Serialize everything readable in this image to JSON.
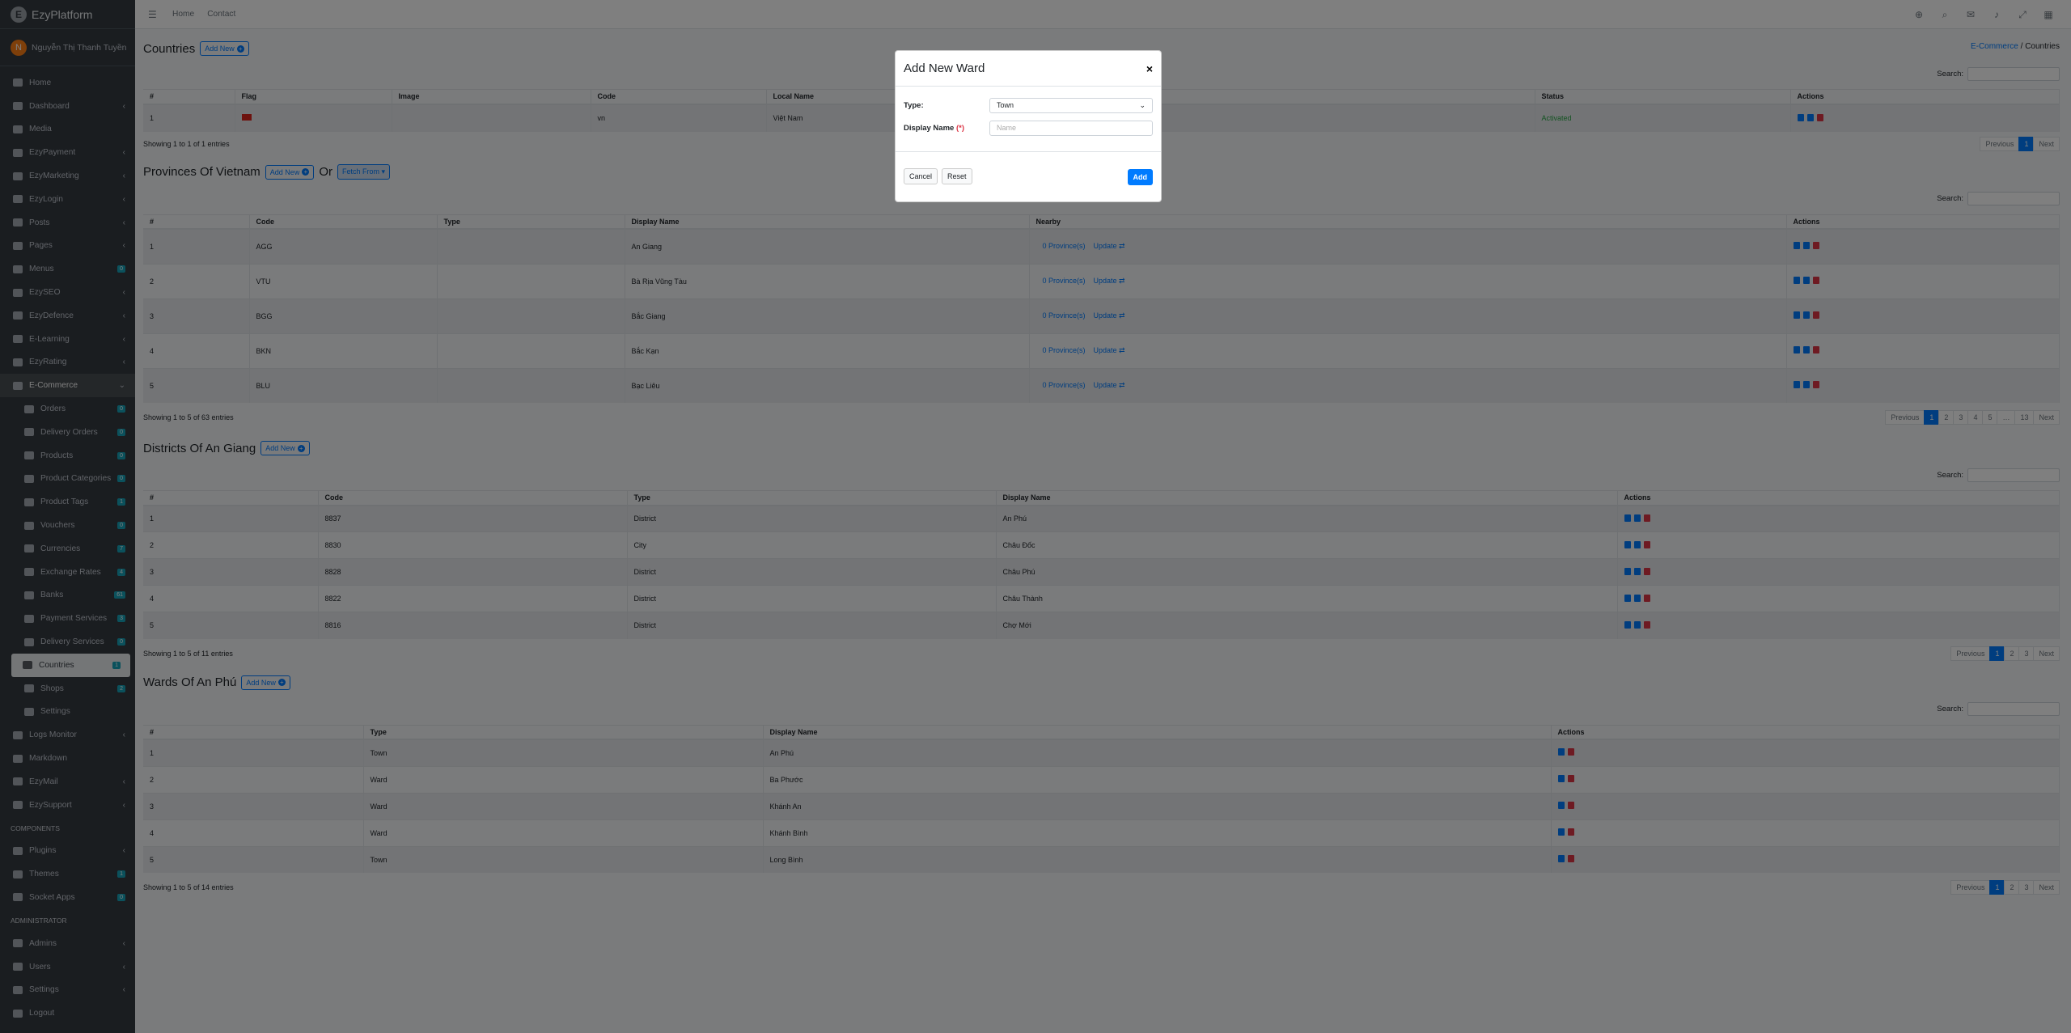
{
  "brand": "EzyPlatform",
  "user": {
    "initial": "N",
    "name": "Nguyễn Thị Thanh Tuyền"
  },
  "sidebar": {
    "top": [
      {
        "label": "Home"
      },
      {
        "label": "Dashboard",
        "chev": "‹"
      },
      {
        "label": "Media"
      },
      {
        "label": "EzyPayment",
        "chev": "‹"
      },
      {
        "label": "EzyMarketing",
        "chev": "‹"
      },
      {
        "label": "EzyLogin",
        "chev": "‹"
      },
      {
        "label": "Posts",
        "chev": "‹"
      },
      {
        "label": "Pages",
        "chev": "‹"
      },
      {
        "label": "Menus",
        "badge": "0"
      },
      {
        "label": "EzySEO",
        "chev": "‹"
      },
      {
        "label": "EzyDefence",
        "chev": "‹"
      },
      {
        "label": "E-Learning",
        "chev": "‹"
      },
      {
        "label": "EzyRating",
        "chev": "‹"
      }
    ],
    "ecommerce": {
      "label": "E-Commerce",
      "chev": "⌄"
    },
    "sub": [
      {
        "label": "Orders",
        "badge": "0"
      },
      {
        "label": "Delivery Orders",
        "badge": "0"
      },
      {
        "label": "Products",
        "badge": "0"
      },
      {
        "label": "Product Categories",
        "badge": "0"
      },
      {
        "label": "Product Tags",
        "badge": "1"
      },
      {
        "label": "Vouchers",
        "badge": "0"
      },
      {
        "label": "Currencies",
        "badge": "7"
      },
      {
        "label": "Exchange Rates",
        "badge": "4"
      },
      {
        "label": "Banks",
        "badge": "61"
      },
      {
        "label": "Payment Services",
        "badge": "3"
      },
      {
        "label": "Delivery Services",
        "badge": "0"
      },
      {
        "label": "Countries",
        "badge": "1"
      },
      {
        "label": "Shops",
        "badge": "2"
      },
      {
        "label": "Settings"
      }
    ],
    "after": [
      {
        "label": "Logs Monitor",
        "chev": "‹"
      },
      {
        "label": "Markdown"
      },
      {
        "label": "EzyMail",
        "chev": "‹"
      },
      {
        "label": "EzySupport",
        "chev": "‹"
      }
    ],
    "components_header": "COMPONENTS",
    "components": [
      {
        "label": "Plugins",
        "chev": "‹"
      },
      {
        "label": "Themes",
        "badge": "1"
      },
      {
        "label": "Socket Apps",
        "badge": "0"
      }
    ],
    "admin_header": "ADMINISTRATOR",
    "admin": [
      {
        "label": "Admins",
        "chev": "‹"
      },
      {
        "label": "Users",
        "chev": "‹"
      },
      {
        "label": "Settings",
        "chev": "‹"
      },
      {
        "label": "Logout"
      }
    ]
  },
  "topbar": {
    "home": "Home",
    "contact": "Contact"
  },
  "breadcrumb": {
    "parent": "E-Commerce",
    "sep": "/",
    "current": "Countries"
  },
  "add_new": "Add New",
  "search_label": "Search:",
  "countries": {
    "title": "Countries",
    "headers": [
      "#",
      "Flag",
      "Image",
      "Code",
      "Local Name",
      "Status",
      "Actions"
    ],
    "rows": [
      {
        "n": "1",
        "code": "vn",
        "local": "Việt Nam",
        "status": "Activated"
      }
    ],
    "info": "Showing 1 to 1 of 1 entries",
    "pages": [
      "Previous",
      "1",
      "Next"
    ]
  },
  "provinces": {
    "title": "Provinces Of Vietnam",
    "or": "Or",
    "fetch": "Fetch From ▾",
    "headers": [
      "#",
      "Code",
      "Type",
      "Display Name",
      "Nearby",
      "Actions"
    ],
    "rows": [
      {
        "n": "1",
        "code": "AGG",
        "name": "An Giang"
      },
      {
        "n": "2",
        "code": "VTU",
        "name": "Bà Rịa Vũng Tàu"
      },
      {
        "n": "3",
        "code": "BGG",
        "name": "Bắc Giang"
      },
      {
        "n": "4",
        "code": "BKN",
        "name": "Bắc Kạn"
      },
      {
        "n": "5",
        "code": "BLU",
        "name": "Bạc Liêu"
      }
    ],
    "nearby": "0 Province(s)",
    "update": "Update",
    "info": "Showing 1 to 5 of 63 entries",
    "pages": [
      "Previous",
      "1",
      "2",
      "3",
      "4",
      "5",
      "…",
      "13",
      "Next"
    ]
  },
  "districts": {
    "title": "Districts Of An Giang",
    "headers": [
      "#",
      "Code",
      "Type",
      "Display Name",
      "Actions"
    ],
    "rows": [
      {
        "n": "1",
        "code": "8837",
        "type": "District",
        "name": "An Phú"
      },
      {
        "n": "2",
        "code": "8830",
        "type": "City",
        "name": "Châu Đốc"
      },
      {
        "n": "3",
        "code": "8828",
        "type": "District",
        "name": "Châu Phú"
      },
      {
        "n": "4",
        "code": "8822",
        "type": "District",
        "name": "Châu Thành"
      },
      {
        "n": "5",
        "code": "8816",
        "type": "District",
        "name": "Chợ Mới"
      }
    ],
    "info": "Showing 1 to 5 of 11 entries",
    "pages": [
      "Previous",
      "1",
      "2",
      "3",
      "Next"
    ]
  },
  "wards": {
    "title": "Wards Of An Phú",
    "headers": [
      "#",
      "Type",
      "Display Name",
      "Actions"
    ],
    "rows": [
      {
        "n": "1",
        "type": "Town",
        "name": "An Phú"
      },
      {
        "n": "2",
        "type": "Ward",
        "name": "Ba Phước"
      },
      {
        "n": "3",
        "type": "Ward",
        "name": "Khánh An"
      },
      {
        "n": "4",
        "type": "Ward",
        "name": "Khánh Bình"
      },
      {
        "n": "5",
        "type": "Town",
        "name": "Long Bình"
      }
    ],
    "info": "Showing 1 to 5 of 14 entries",
    "pages": [
      "Previous",
      "1",
      "2",
      "3",
      "Next"
    ]
  },
  "modal": {
    "title": "Add New Ward",
    "close": "×",
    "type_label": "Type:",
    "type_value": "Town",
    "name_label": "Display Name",
    "req": "(*)",
    "name_placeholder": "Name",
    "cancel": "Cancel",
    "reset": "Reset",
    "add": "Add"
  },
  "colors": {
    "primary": "#007bff",
    "sidebar": "#343a40",
    "danger": "#dc3545",
    "success": "#28a745"
  }
}
